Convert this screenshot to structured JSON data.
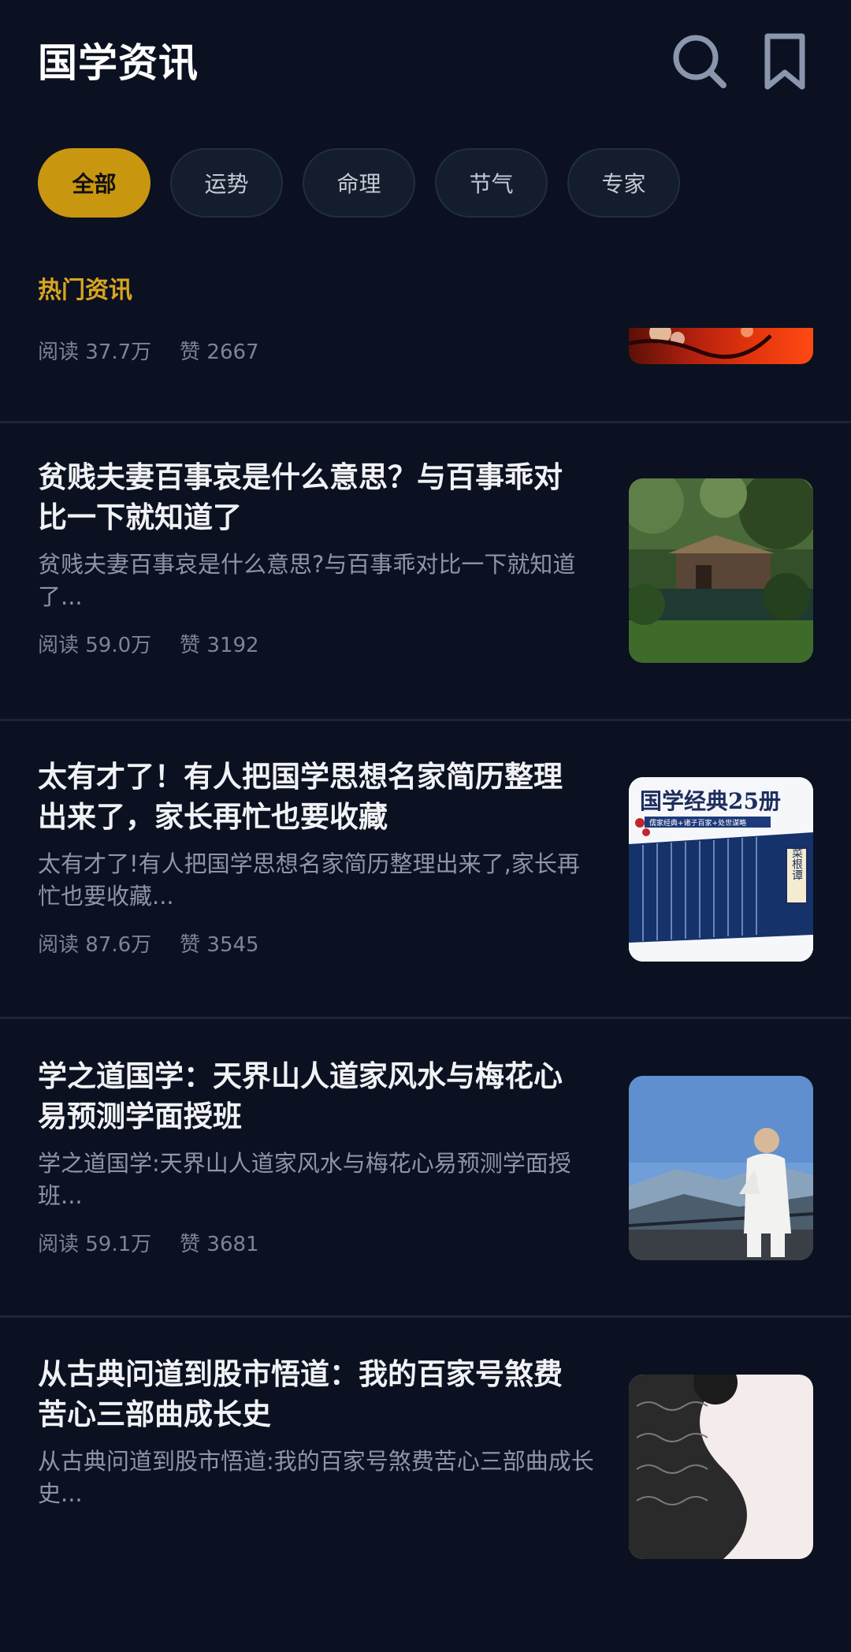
{
  "header": {
    "title": "国学资讯"
  },
  "tabs": [
    {
      "label": "全部",
      "active": true
    },
    {
      "label": "运势",
      "active": false
    },
    {
      "label": "命理",
      "active": false
    },
    {
      "label": "节气",
      "active": false
    },
    {
      "label": "专家",
      "active": false
    }
  ],
  "section_title": "热门资讯",
  "partial_item": {
    "reads": "阅读 37.7万",
    "likes": "赞 2667"
  },
  "articles": [
    {
      "title": "贫贱夫妻百事哀是什么意思？与百事乖对比一下就知道了",
      "summary": "贫贱夫妻百事哀是什么意思?与百事乖对比一下就知道了...",
      "reads": "阅读 59.0万",
      "likes": "赞 3192"
    },
    {
      "title": "太有才了！有人把国学思想名家简历整理出来了，家长再忙也要收藏",
      "summary": "太有才了!有人把国学思想名家简历整理出来了,家长再忙也要收藏...",
      "reads": "阅读 87.6万",
      "likes": "赞 3545",
      "thumb_text": {
        "title": "国学经典25册",
        "subtitle": "儒家经典+诸子百家+处世谋略",
        "spine": "菜根谭"
      }
    },
    {
      "title": "学之道国学：天界山人道家风水与梅花心易预测学面授班",
      "summary": "学之道国学:天界山人道家风水与梅花心易预测学面授班...",
      "reads": "阅读 59.1万",
      "likes": "赞 3681"
    },
    {
      "title": "从古典问道到股市悟道：我的百家号煞费苦心三部曲成长史",
      "summary": "从古典问道到股市悟道:我的百家号煞费苦心三部曲成长史..."
    }
  ],
  "colors": {
    "background": "#0b1120",
    "accent": "#c9960f",
    "section": "#d9a520"
  }
}
